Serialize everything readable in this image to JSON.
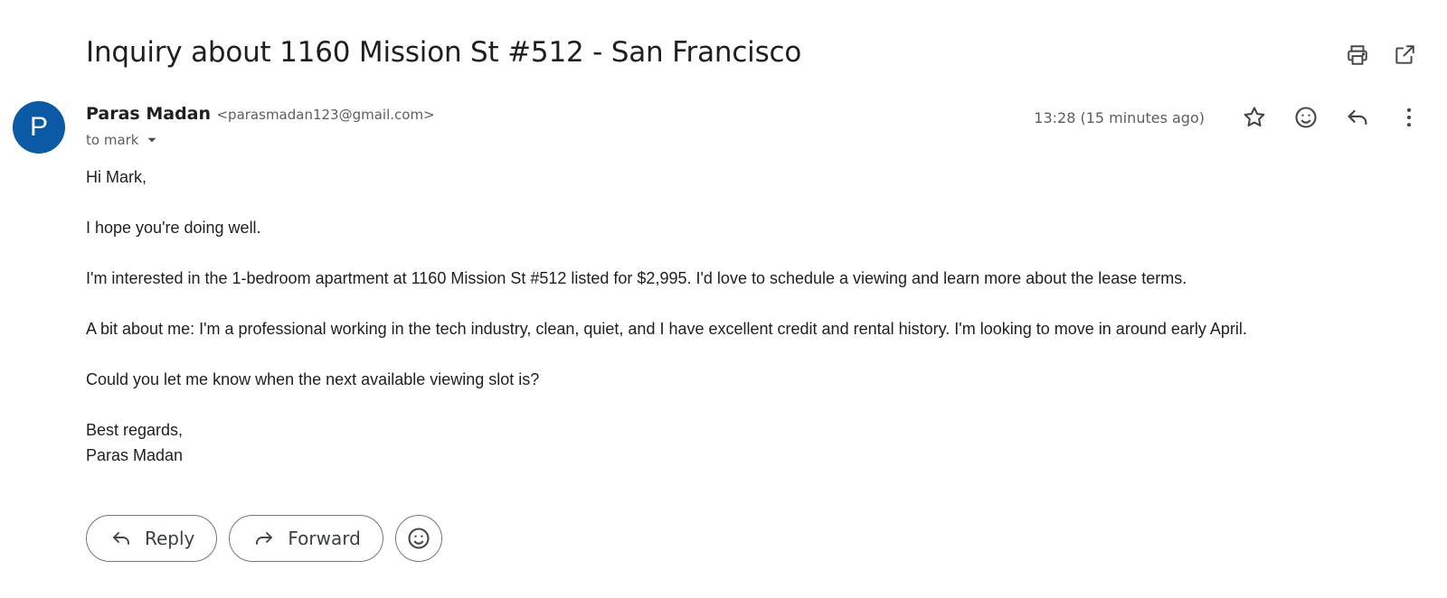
{
  "email": {
    "subject": "Inquiry about 1160 Mission St #512 - San Francisco",
    "sender": {
      "initial": "P",
      "name": "Paras Madan",
      "email": "<parasmadan123@gmail.com>",
      "avatar_color": "#0b5aa6"
    },
    "to_label": "to mark",
    "timestamp": "13:28 (15 minutes ago)",
    "body": {
      "greeting": "Hi Mark,",
      "p1": "I hope you're doing well.",
      "p2": "I'm interested in the 1-bedroom apartment at 1160 Mission St #512 listed for $2,995. I'd love to schedule a viewing and learn more about the lease terms.",
      "p3": "A bit about me: I'm a professional working in the tech industry, clean, quiet, and I have excellent credit and rental history. I'm looking to move in around early April.",
      "p4": "Could you let me know when the next available viewing slot is?",
      "signoff": "Best regards,",
      "signature": "Paras Madan"
    }
  },
  "actions": {
    "reply_label": "Reply",
    "forward_label": "Forward"
  },
  "icons": {
    "print": "print-icon",
    "open_new_window": "open-in-new-window-icon",
    "star": "star-icon",
    "emoji": "emoji-icon",
    "reply": "reply-icon",
    "more": "more-vertical-icon",
    "forward": "forward-icon",
    "dropdown": "chevron-down-icon"
  }
}
